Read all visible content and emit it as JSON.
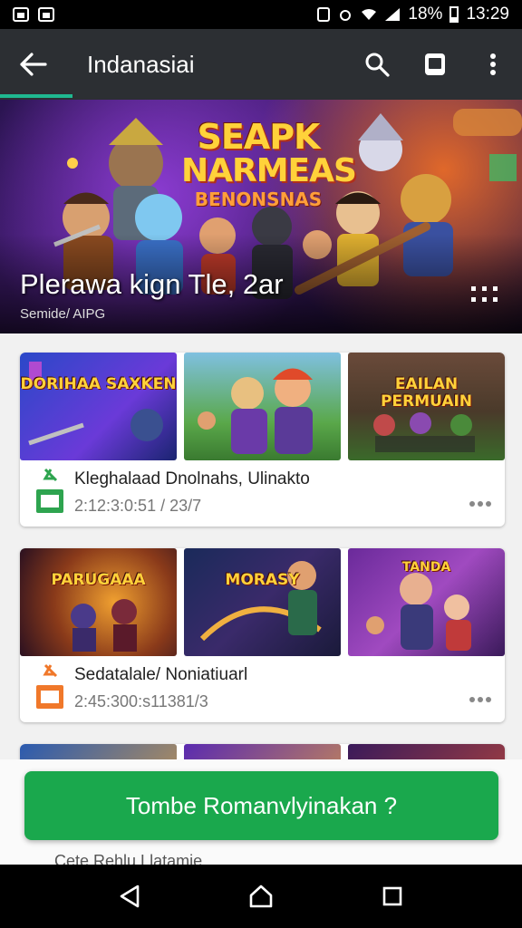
{
  "status_bar": {
    "battery": "18%",
    "time": "13:29"
  },
  "app_bar": {
    "title": "Indanasiai",
    "back_icon": "arrow-back-icon",
    "actions": [
      "search-icon",
      "cast-icon",
      "more-vert-icon"
    ]
  },
  "hero": {
    "logo_line1": "SEAPK",
    "logo_line2": "NARMEAS",
    "logo_line3": "BENONSNAS",
    "title": "Plerawa kign Tle, 2ar",
    "subtitle": "Semide/ AIPG"
  },
  "cards": [
    {
      "thumbs": [
        "DORIHAA SAXKEN",
        "",
        "EAILAN PERMUAIN"
      ],
      "title": "Kleghalaad Dnolnahs, Ulinakto",
      "date": "2:12:3:0:51 / 23/7",
      "icon_color": "#2ea44f"
    },
    {
      "thumbs": [
        "PARUGAAA",
        "MORASY",
        "TANDA"
      ],
      "title": "Sedatalale/ Noniatiuarl",
      "date": "2:45:300:s11381/3",
      "icon_color": "#f0782a"
    }
  ],
  "cta": {
    "label": "Tombe Romanvlyinakan ?"
  },
  "peek_text": "Cete Rehlu Llatamie",
  "colors": {
    "accent": "#1fb890",
    "cta": "#1aa84d",
    "appbar": "#2c2f33"
  }
}
